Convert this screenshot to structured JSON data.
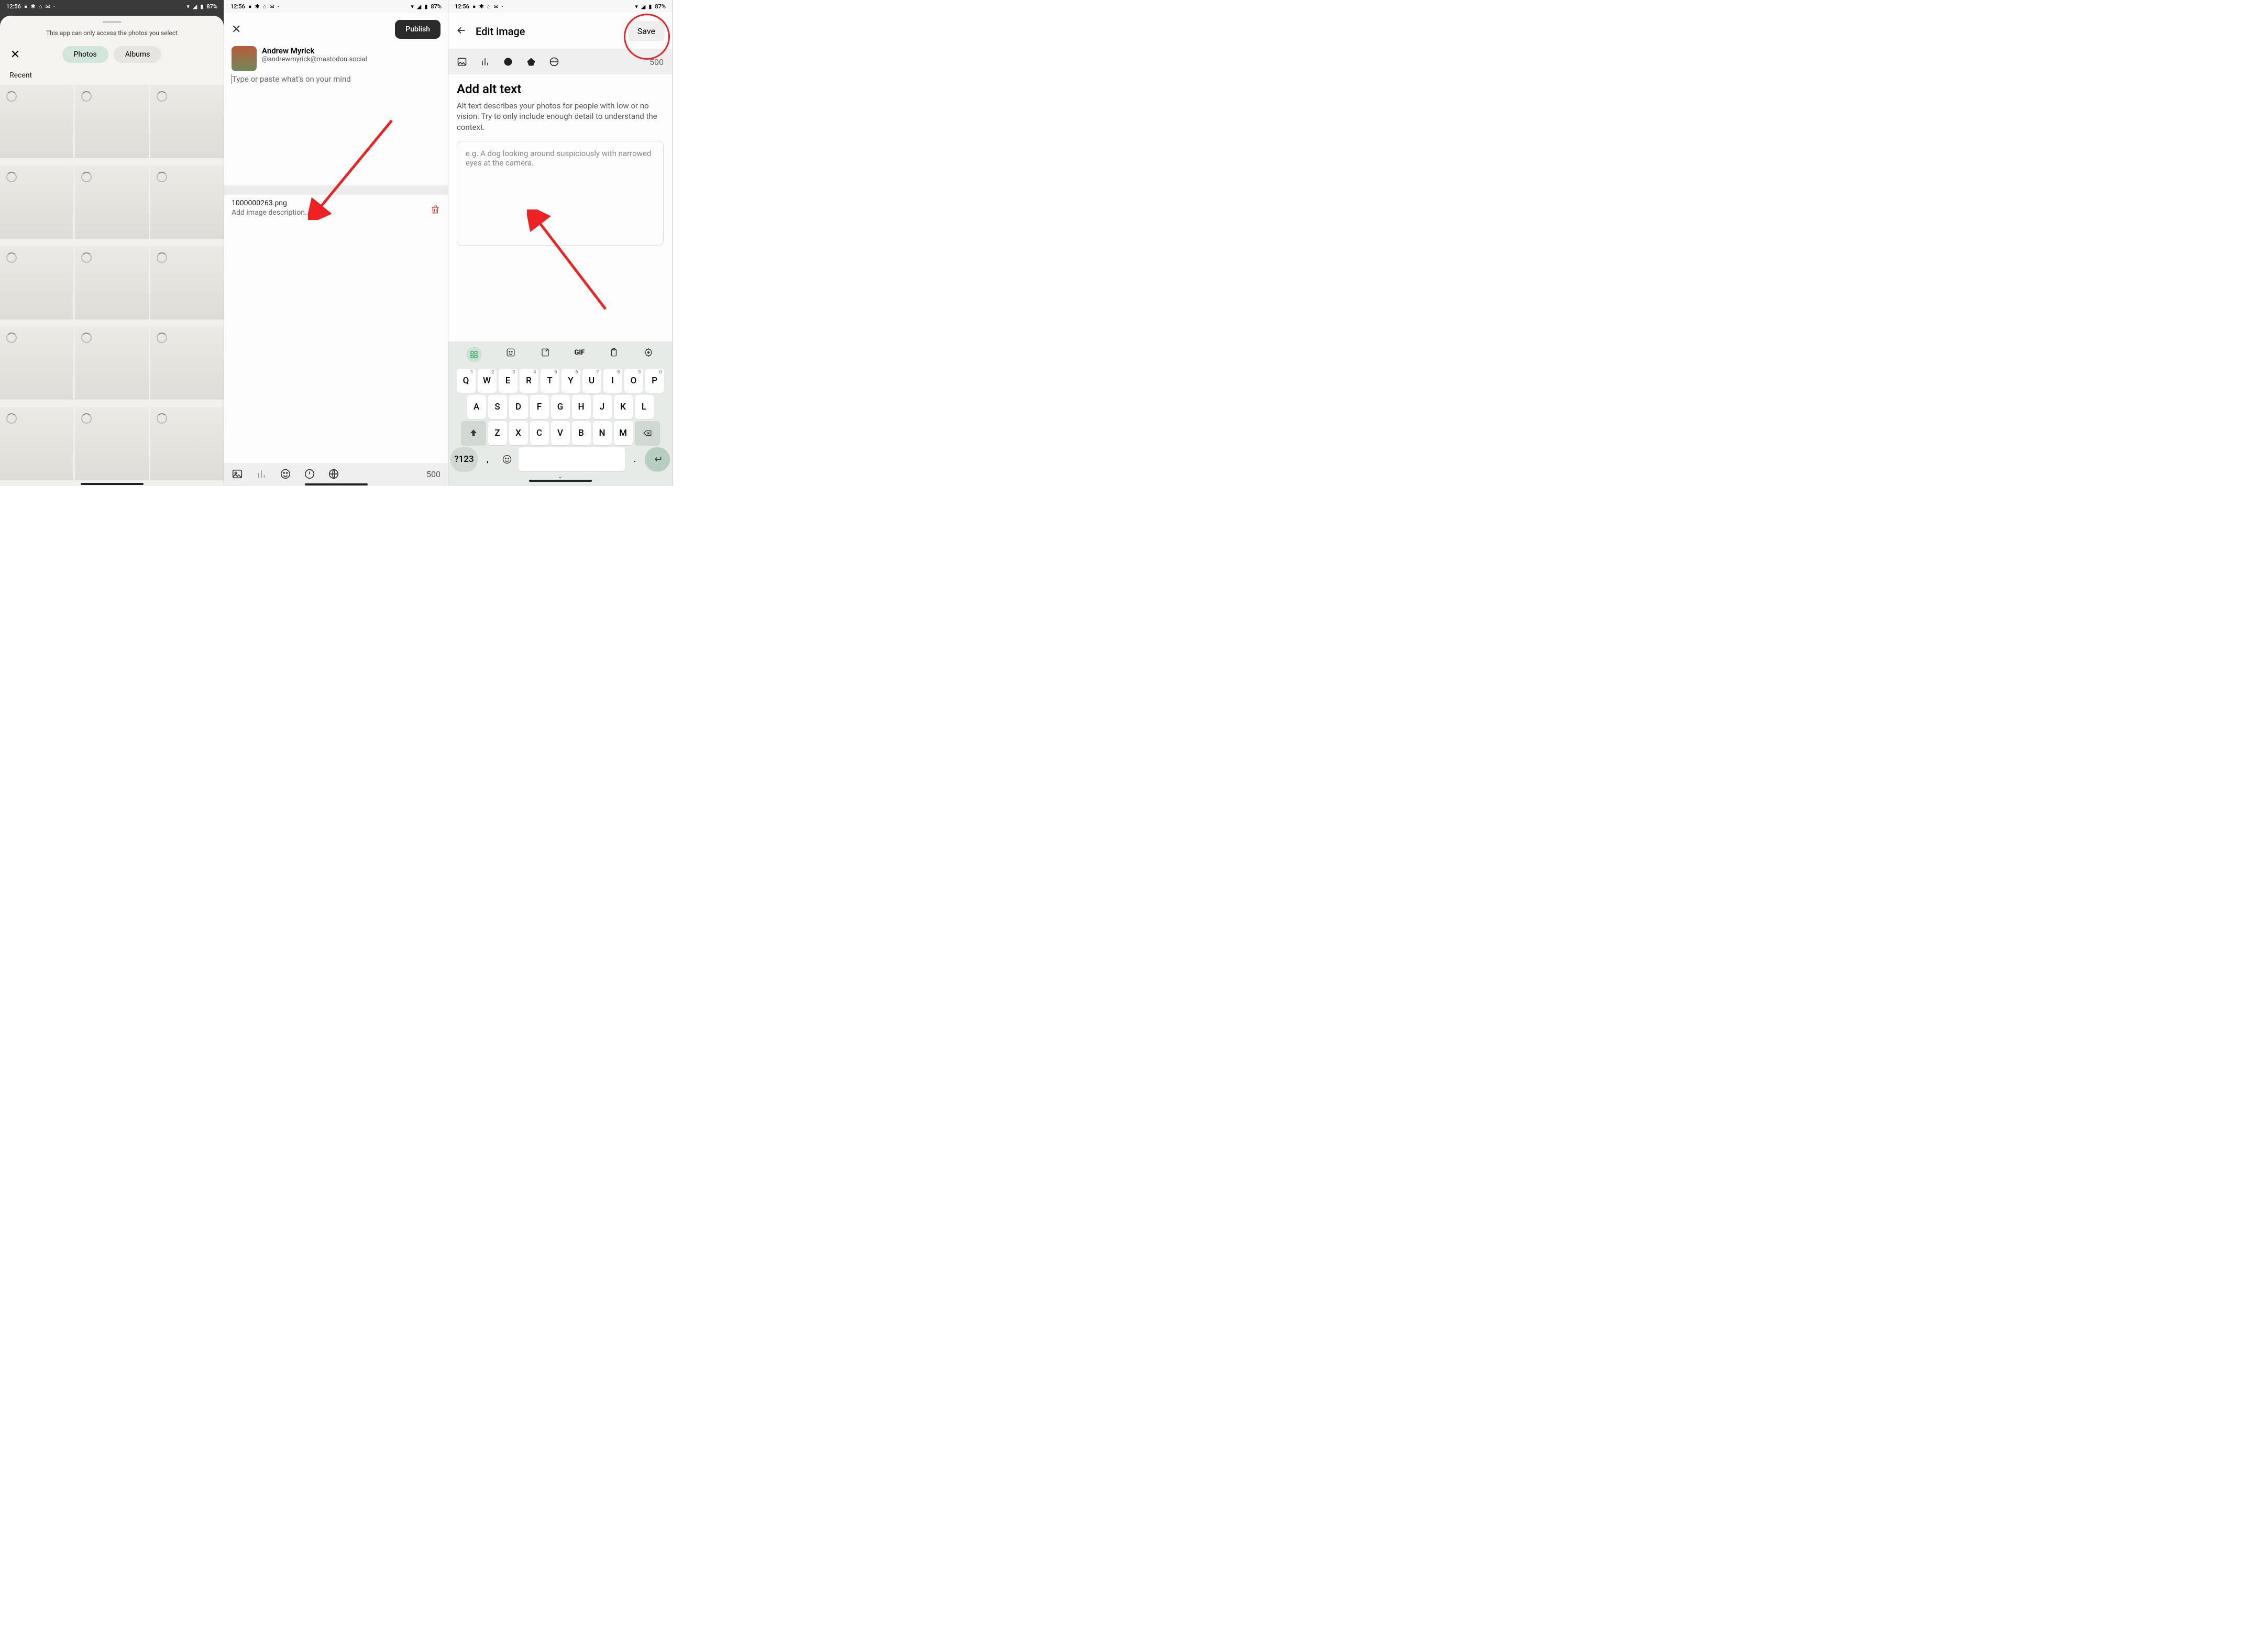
{
  "status": {
    "time": "12:56",
    "battery": "87%",
    "icons": [
      "messenger",
      "slack",
      "home",
      "mail",
      "dot"
    ],
    "right_icons": [
      "wifi",
      "signal",
      "battery-charging"
    ]
  },
  "phone1": {
    "access_hint": "This app can only access the photos you select",
    "tab_photos": "Photos",
    "tab_albums": "Albums",
    "section": "Recent"
  },
  "phone2": {
    "publish": "Publish",
    "display_name": "Andrew Myrick",
    "handle": "@andrewmyrick@mastodon.social",
    "placeholder": "Type or paste what's on your mind",
    "filename": "1000000263.png",
    "add_desc": "Add image description…",
    "char_count": "500"
  },
  "phone3": {
    "title": "Edit image",
    "save": "Save",
    "tool_count": "500",
    "heading": "Add alt text",
    "explain": "Alt text describes your photos for people with low or no vision. Try to only include enough detail to understand the context.",
    "placeholder": "e.g. A dog looking around suspiciously with narrowed eyes at the camera.",
    "kb": {
      "row1": [
        "Q",
        "W",
        "E",
        "R",
        "T",
        "Y",
        "U",
        "I",
        "O",
        "P"
      ],
      "row1_sup": [
        "1",
        "2",
        "3",
        "4",
        "5",
        "6",
        "7",
        "8",
        "9",
        "0"
      ],
      "row2": [
        "A",
        "S",
        "D",
        "F",
        "G",
        "H",
        "J",
        "K",
        "L"
      ],
      "row3": [
        "Z",
        "X",
        "C",
        "V",
        "B",
        "N",
        "M"
      ],
      "sym": "?123",
      "comma": ",",
      "period": ".",
      "gif": "GIF"
    }
  }
}
